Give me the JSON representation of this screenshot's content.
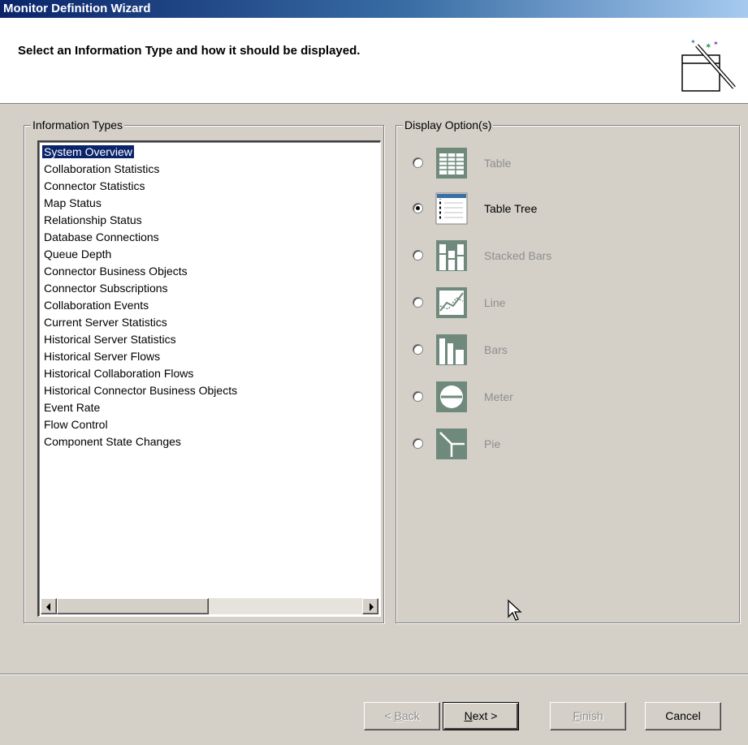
{
  "window": {
    "title": "Monitor Definition Wizard"
  },
  "header": {
    "subtitle": "Select an Information Type and how it should be displayed.",
    "icon": "wizard-wand-icon"
  },
  "information_types": {
    "label": "Information Types",
    "items": [
      "System Overview",
      "Collaboration Statistics",
      "Connector Statistics",
      "Map Status",
      "Relationship Status",
      "Database Connections",
      "Queue Depth",
      "Connector Business Objects",
      "Connector Subscriptions",
      "Collaboration Events",
      "Current Server Statistics",
      "Historical Server Statistics",
      "Historical Server Flows",
      "Historical Collaboration Flows",
      "Historical Connector Business Objects",
      "Event Rate",
      "Flow Control",
      "Component State Changes"
    ],
    "selected": "System Overview"
  },
  "display_options": {
    "label": "Display Option(s)",
    "options": [
      {
        "label": "Table",
        "icon": "table-icon",
        "enabled": false,
        "checked": false
      },
      {
        "label": "Table Tree",
        "icon": "table-tree-icon",
        "enabled": true,
        "checked": true
      },
      {
        "label": "Stacked Bars",
        "icon": "stacked-bars-icon",
        "enabled": false,
        "checked": false
      },
      {
        "label": "Line",
        "icon": "line-chart-icon",
        "enabled": false,
        "checked": false
      },
      {
        "label": "Bars",
        "icon": "bars-icon",
        "enabled": false,
        "checked": false
      },
      {
        "label": "Meter",
        "icon": "meter-icon",
        "enabled": false,
        "checked": false
      },
      {
        "label": "Pie",
        "icon": "pie-icon",
        "enabled": false,
        "checked": false
      }
    ]
  },
  "buttons": {
    "back": {
      "prefix": "< ",
      "mnemonic": "B",
      "rest": "ack",
      "enabled": false
    },
    "next": {
      "mnemonic": "N",
      "rest": "ext >",
      "enabled": true
    },
    "finish": {
      "mnemonic": "F",
      "rest": "inish",
      "enabled": false
    },
    "cancel": {
      "label": "Cancel",
      "enabled": true
    }
  },
  "colors": {
    "selection": "#0a246a",
    "face": "#d4d0c8",
    "disabled_text": "#8e8e8e",
    "icon_fill": "#6f8a7c"
  }
}
